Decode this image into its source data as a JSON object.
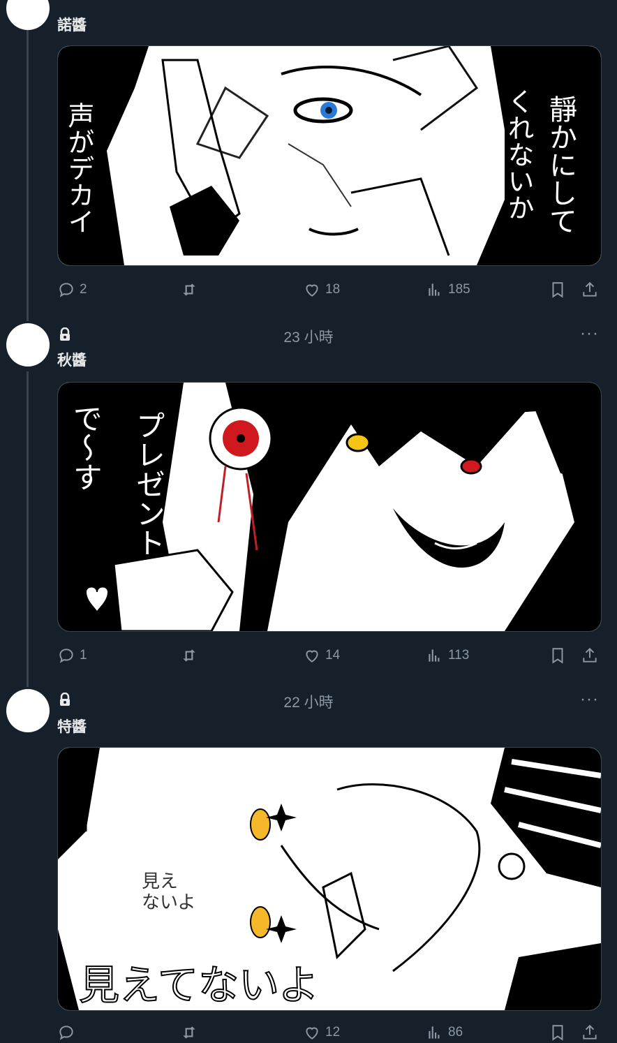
{
  "posts": [
    {
      "name": "諾醬",
      "time": "",
      "media_text": [
        "靜かにして",
        "くれないか",
        "声がデカイ"
      ],
      "stats": {
        "replies": "2",
        "retweets": "",
        "likes": "18",
        "views": "185"
      }
    },
    {
      "name": "秋醬",
      "time": "23 小時",
      "media_text": [
        "プレゼント",
        "で〜す"
      ],
      "stats": {
        "replies": "1",
        "retweets": "",
        "likes": "14",
        "views": "113"
      }
    },
    {
      "name": "特醬",
      "time": "22 小時",
      "media_text": [
        "見え",
        "ないよ",
        "見えてないよ"
      ],
      "stats": {
        "replies": "",
        "retweets": "",
        "likes": "12",
        "views": "86"
      }
    }
  ],
  "colors": {
    "background": "#15202b",
    "text": "#e7e9ea",
    "muted": "#8b98a5",
    "border": "#38444d"
  }
}
